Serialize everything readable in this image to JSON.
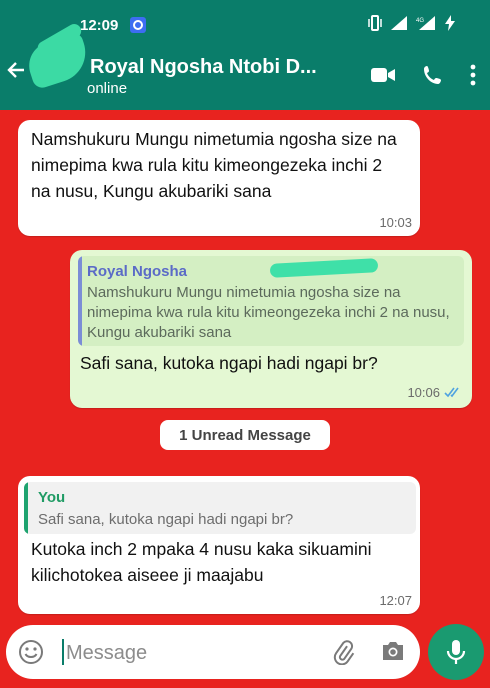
{
  "status_bar": {
    "time": "12:09"
  },
  "header": {
    "contact_name": "Royal Ngosha Ntobi D...",
    "contact_status": "online"
  },
  "messages": [
    {
      "direction": "incoming",
      "text": "Namshukuru Mungu nimetumia ngosha size na nimepima kwa rula kitu kimeongezeka inchi 2 na nusu, Kungu akubariki sana",
      "time": "10:03"
    },
    {
      "direction": "outgoing",
      "quote_name": "Royal Ngosha",
      "quote_text": "Namshukuru Mungu nimetumia ngosha size na nimepima kwa rula kitu kimeongezeka inchi 2 na nusu, Kungu akubariki sana",
      "text": "Safi sana, kutoka ngapi hadi ngapi br?",
      "time": "10:06"
    },
    {
      "direction": "incoming",
      "quote_name": "You",
      "quote_text": "Safi sana, kutoka ngapi hadi ngapi br?",
      "text": "Kutoka inch 2 mpaka 4 nusu kaka sikuamini kilichotokea aiseee ji maajabu",
      "time": "12:07"
    }
  ],
  "unread_label": "1 Unread Message",
  "composer": {
    "placeholder": "Message"
  },
  "colors": {
    "header_bg": "#0a7d6a",
    "wallpaper": "#e8231f",
    "outgoing_bubble": "#e4f8d3",
    "incoming_bubble": "#ffffff",
    "mic_button": "#1a9a70",
    "read_ticks": "#4fa3e0"
  },
  "icons": [
    "back-arrow-icon",
    "video-call-icon",
    "phone-icon",
    "more-options-icon",
    "emoji-icon",
    "attach-icon",
    "camera-icon",
    "mic-icon",
    "double-check-icon"
  ]
}
